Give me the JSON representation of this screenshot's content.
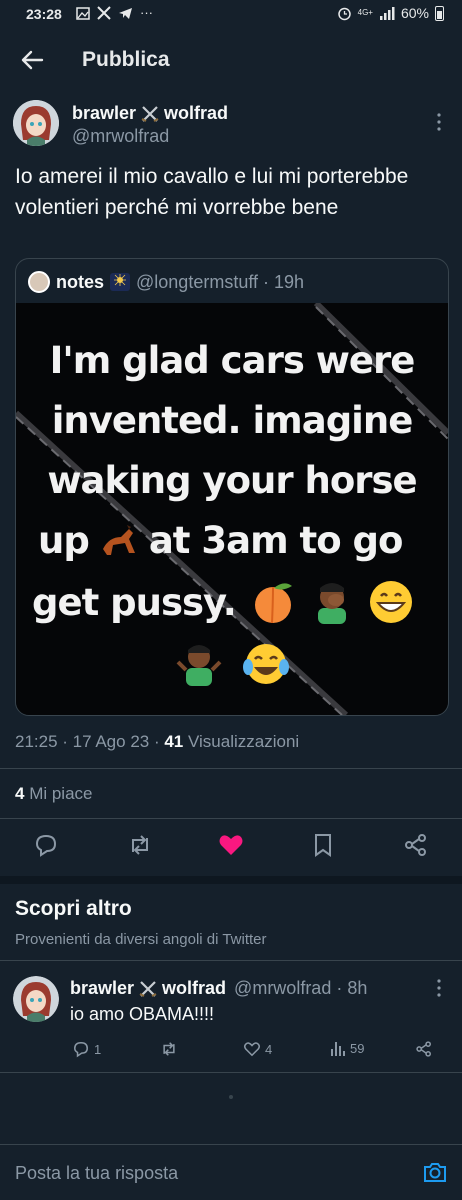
{
  "status_bar": {
    "time": "23:28",
    "network": "4G+",
    "battery": "60%"
  },
  "header": {
    "title": "Pubblica"
  },
  "post": {
    "display_name_first": "brawler",
    "display_name_last": "wolfrad",
    "handle": "@mrwolfrad",
    "text": "Io amerei il mio cavallo e lui mi porterebbe volentieri perché mi vorrebbe bene",
    "quote": {
      "name": "notes",
      "meta": "@longtermstuff · 19h",
      "image_text": [
        "I'm glad cars were",
        "invented. imagine",
        "waking your horse",
        "up",
        "at 3am to go",
        "get pussy."
      ]
    },
    "timestamp_prefix": "21:25 · 17 Ago 23 · ",
    "views_count": "41",
    "views_label": " Visualizzazioni",
    "likes_count": "4",
    "likes_label": " Mi piace"
  },
  "discover": {
    "title": "Scopri altro",
    "subtitle": "Provenienti da diversi angoli di Twitter"
  },
  "reply": {
    "display_name_first": "brawler",
    "display_name_last": "wolfrad",
    "meta": "@mrwolfrad · 8h",
    "text": "io amo OBAMA!!!!",
    "reply_count": "1",
    "like_count": "4",
    "views_count": "59"
  },
  "composer": {
    "placeholder": "Posta la tua risposta"
  },
  "colors": {
    "background": "#15202b",
    "accent_blue": "#1d9bf0",
    "like_pink": "#f91880",
    "secondary_text": "#8b98a5"
  }
}
